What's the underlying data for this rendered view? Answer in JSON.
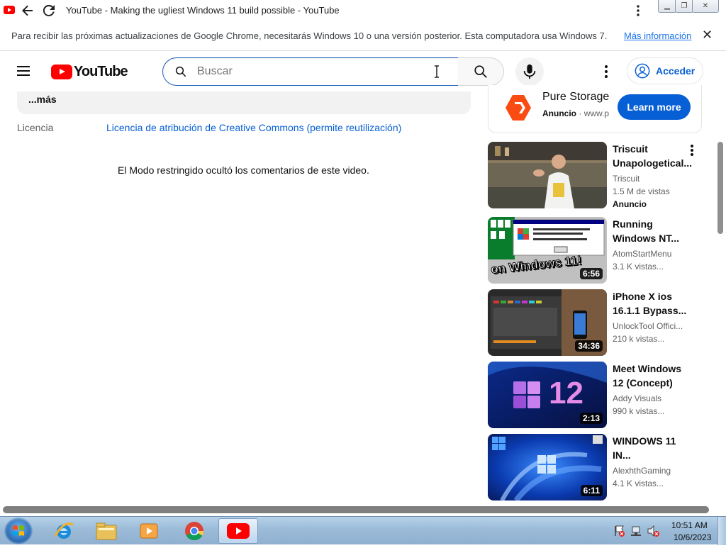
{
  "browser": {
    "tab_title": "YouTube - Making the ugliest Windows 11 build possible - YouTube"
  },
  "infobar": {
    "message": "Para recibir las próximas actualizaciones de Google Chrome, necesitarás Windows 10 o una versión posterior. Esta computadora usa Windows 7.",
    "link": "Más información"
  },
  "header": {
    "logo_text": "YouTube",
    "search_placeholder": "Buscar",
    "signin_label": "Acceder"
  },
  "main": {
    "description_more": "...más",
    "license_label": "Licencia",
    "license_value": "Licencia de atribución de Creative Commons (permite reutilización)",
    "comments_notice": "El Modo restringido ocultó los comentarios de este video."
  },
  "ad": {
    "name": "Pure Storage",
    "label": "Anuncio",
    "separator": "·",
    "url": "www.p",
    "cta": "Learn more"
  },
  "videos": [
    {
      "title1": "Triscuit",
      "title2": "Unapologetical...",
      "channel": "Triscuit",
      "views": "1.5 M de vistas",
      "badge": "Anuncio",
      "duration": ""
    },
    {
      "title1": "Running",
      "title2": "Windows NT...",
      "channel": "AtomStartMenu",
      "views": "3.1 K vistas...",
      "badge": "",
      "duration": "6:56",
      "overlay": "on Windows 11!"
    },
    {
      "title1": "iPhone X ios",
      "title2": "16.1.1 Bypass...",
      "channel": "UnlockTool Offici...",
      "views": "210 k vistas...",
      "badge": "",
      "duration": "34:36"
    },
    {
      "title1": "Meet Windows",
      "title2": "12 (Concept)",
      "channel": "Addy Visuals",
      "views": "990 k vistas...",
      "badge": "",
      "duration": "2:13",
      "overlay": "12"
    },
    {
      "title1": "WINDOWS 11",
      "title2": "IN...",
      "channel": "AlexhthGaming",
      "views": "4.1 K vistas...",
      "badge": "",
      "duration": "6:11"
    }
  ],
  "taskbar": {
    "time": "10:51 AM",
    "date": "10/6/2023"
  },
  "colors": {
    "youtube_red": "#ff0000",
    "link_blue": "#065fd4",
    "chrome_link": "#1a73e8"
  }
}
